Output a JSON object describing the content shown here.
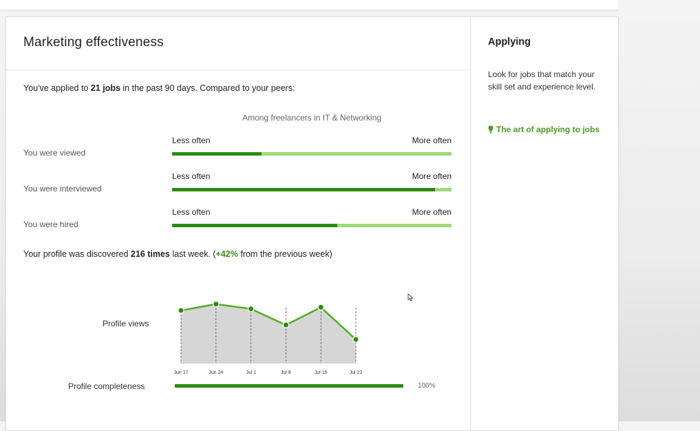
{
  "main": {
    "title": "Marketing effectiveness",
    "applied": {
      "prefix": "You've applied to ",
      "count": "21 jobs",
      "suffix": " in the past 90 days. Compared to your peers:"
    },
    "peers_caption": "Among freelancers in IT & Networking",
    "metrics": [
      {
        "label": "You were viewed",
        "less": "Less often",
        "more": "More often",
        "level_percent": 32
      },
      {
        "label": "You were interviewed",
        "less": "Less often",
        "more": "More often",
        "level_percent": 94
      },
      {
        "label": "You were hired",
        "less": "Less often",
        "more": "More often",
        "level_percent": 59
      }
    ],
    "discovered": {
      "prefix": "Your profile was discovered ",
      "count": "216 times",
      "middle": " last week. (",
      "change": "+42%",
      "suffix": " from the previous week)"
    },
    "profile_views_label": "Profile views",
    "profile_completeness": {
      "label": "Profile completeness",
      "value_text": "100%",
      "level_percent": 100
    }
  },
  "chart_data": {
    "type": "area",
    "categories": [
      "Jun 17",
      "Jun 24",
      "Jul 1",
      "Jul 8",
      "Jul 15",
      "Jul 22"
    ],
    "values": [
      33,
      37,
      34,
      24,
      35,
      15
    ],
    "ylim": [
      0,
      45
    ],
    "grid": "dashed vertical lines at each category",
    "line_color": "#4caf1f",
    "fill_color": "#d6d6d6"
  },
  "side": {
    "title": "Applying",
    "description": "Look for jobs that match your skill set and experience level.",
    "link_text": "The art of applying to jobs",
    "link_icon": "lightbulb-icon"
  },
  "colors": {
    "bar_dark": "#2f8a10",
    "bar_light": "#9fd97a",
    "accent_green": "#4b9a23"
  }
}
